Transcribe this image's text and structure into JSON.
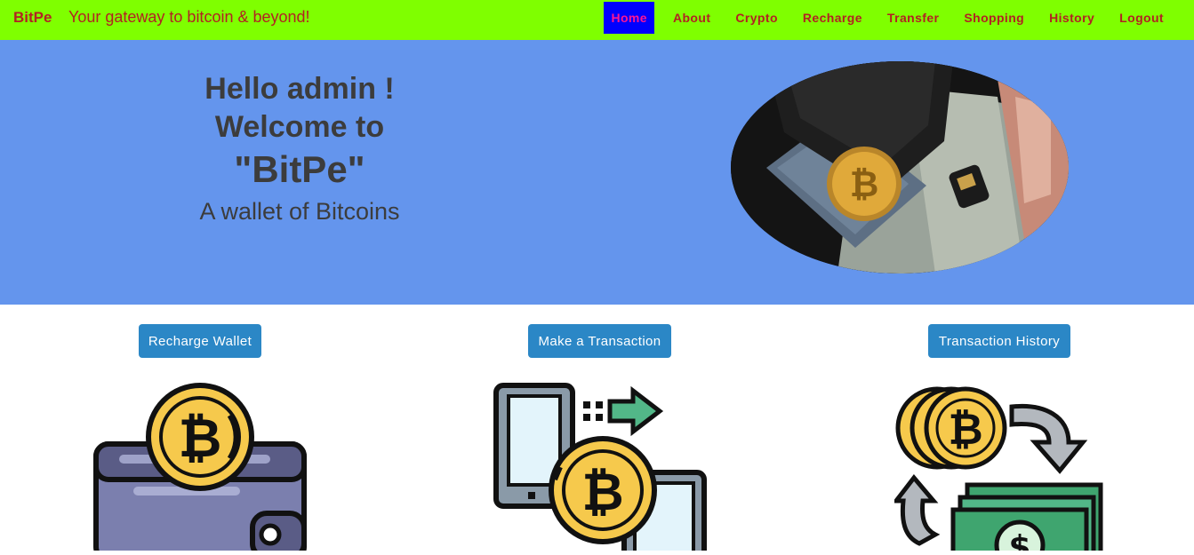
{
  "navbar": {
    "brand": "BitPe",
    "tagline": "Your gateway to bitcoin & beyond!",
    "links": [
      {
        "label": "Home",
        "active": true
      },
      {
        "label": "About"
      },
      {
        "label": "Crypto"
      },
      {
        "label": "Recharge"
      },
      {
        "label": "Transfer"
      },
      {
        "label": "Shopping"
      },
      {
        "label": "History"
      },
      {
        "label": "Logout"
      }
    ]
  },
  "hero": {
    "line1": "Hello admin !",
    "line2": "Welcome to",
    "line3": "\"BitPe\"",
    "subtitle": "A wallet of Bitcoins",
    "image_icon": "wallet-bitcoin-photo"
  },
  "actions": [
    {
      "label": "Recharge Wallet",
      "icon": "wallet-bitcoin-icon"
    },
    {
      "label": "Make a Transaction",
      "icon": "phone-transfer-bitcoin-icon"
    },
    {
      "label": "Transaction History",
      "icon": "bitcoin-exchange-cash-icon"
    }
  ],
  "colors": {
    "navbar_bg": "#7fff00",
    "brand_text": "#b22222",
    "active_bg": "#0000ff",
    "active_text": "#ff1493",
    "hero_bg": "#6495ed",
    "button_bg": "#2b87c6"
  }
}
